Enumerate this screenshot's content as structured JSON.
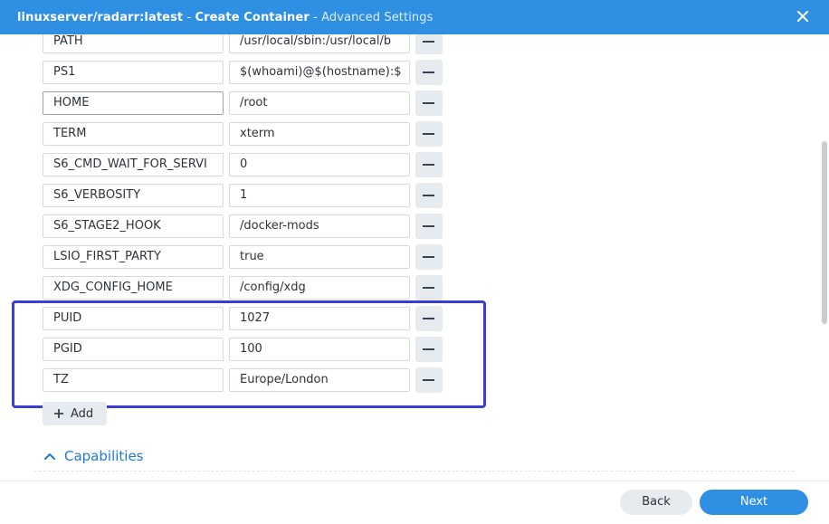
{
  "window": {
    "title_image": "linuxserver/radarr:latest",
    "title_sep": " - ",
    "title_main": "Create Container",
    "title_sub": "Advanced Settings"
  },
  "env_vars": [
    {
      "key": "PATH",
      "value": "/usr/local/sbin:/usr/local/b"
    },
    {
      "key": "PS1",
      "value": "$(whoami)@$(hostname):$"
    },
    {
      "key": "HOME",
      "value": "/root"
    },
    {
      "key": "TERM",
      "value": "xterm"
    },
    {
      "key": "S6_CMD_WAIT_FOR_SERVI",
      "value": "0"
    },
    {
      "key": "S6_VERBOSITY",
      "value": "1"
    },
    {
      "key": "S6_STAGE2_HOOK",
      "value": "/docker-mods"
    },
    {
      "key": "LSIO_FIRST_PARTY",
      "value": "true"
    },
    {
      "key": "XDG_CONFIG_HOME",
      "value": "/config/xdg"
    },
    {
      "key": "PUID",
      "value": "1027"
    },
    {
      "key": "PGID",
      "value": "100"
    },
    {
      "key": "TZ",
      "value": "Europe/London"
    }
  ],
  "add_label": "Add",
  "capabilities_label": "Capabilities",
  "footer": {
    "back_label": "Back",
    "next_label": "Next"
  },
  "colors": {
    "titlebar": "#2f8fe3",
    "highlight": "#3b3bd6",
    "link": "#1f7ad6"
  },
  "icons": {
    "close": "close-icon",
    "remove": "minus-icon",
    "add": "plus-icon",
    "collapse": "chevron-up-icon"
  }
}
